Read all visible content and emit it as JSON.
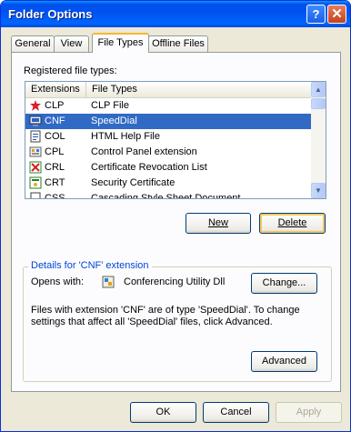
{
  "window": {
    "title": "Folder Options",
    "help_glyph": "?",
    "close_glyph": "✕"
  },
  "tabs": [
    {
      "label": "General",
      "active": false
    },
    {
      "label": "View",
      "active": false
    },
    {
      "label": "File Types",
      "active": true
    },
    {
      "label": "Offline Files",
      "active": false
    }
  ],
  "file_types": {
    "label": "Registered file types:",
    "columns": [
      "Extensions",
      "File Types"
    ],
    "rows": [
      {
        "ext": "CLP",
        "type": "CLP File",
        "icon": "clip-icon",
        "selected": false
      },
      {
        "ext": "CNF",
        "type": "SpeedDial",
        "icon": "speed-dial-icon",
        "selected": true
      },
      {
        "ext": "COL",
        "type": "HTML Help File",
        "icon": "help-file-icon",
        "selected": false
      },
      {
        "ext": "CPL",
        "type": "Control Panel extension",
        "icon": "control-panel-icon",
        "selected": false
      },
      {
        "ext": "CRL",
        "type": "Certificate Revocation List",
        "icon": "revocation-icon",
        "selected": false
      },
      {
        "ext": "CRT",
        "type": "Security Certificate",
        "icon": "certificate-icon",
        "selected": false
      },
      {
        "ext": "CSS",
        "type": "Cascading Style Sheet Document",
        "icon": "stylesheet-icon",
        "selected": false
      }
    ],
    "scroll_up_glyph": "▲",
    "scroll_down_glyph": "▼"
  },
  "buttons": {
    "new": "New",
    "delete": "Delete",
    "change": "Change...",
    "advanced": "Advanced",
    "ok": "OK",
    "cancel": "Cancel",
    "apply": "Apply"
  },
  "details": {
    "group_label": "Details for 'CNF' extension",
    "opens_with_label": "Opens with:",
    "opens_with_value": "Conferencing Utility Dll",
    "description_line1": "Files with extension 'CNF' are of type 'SpeedDial'.  To change",
    "description_line2": "settings that affect all 'SpeedDial' files, click Advanced."
  },
  "colors": {
    "title_bar": "#0054e3",
    "selection": "#316ac5",
    "group_label": "#0046d5",
    "dialog_bg": "#ece9d8"
  }
}
